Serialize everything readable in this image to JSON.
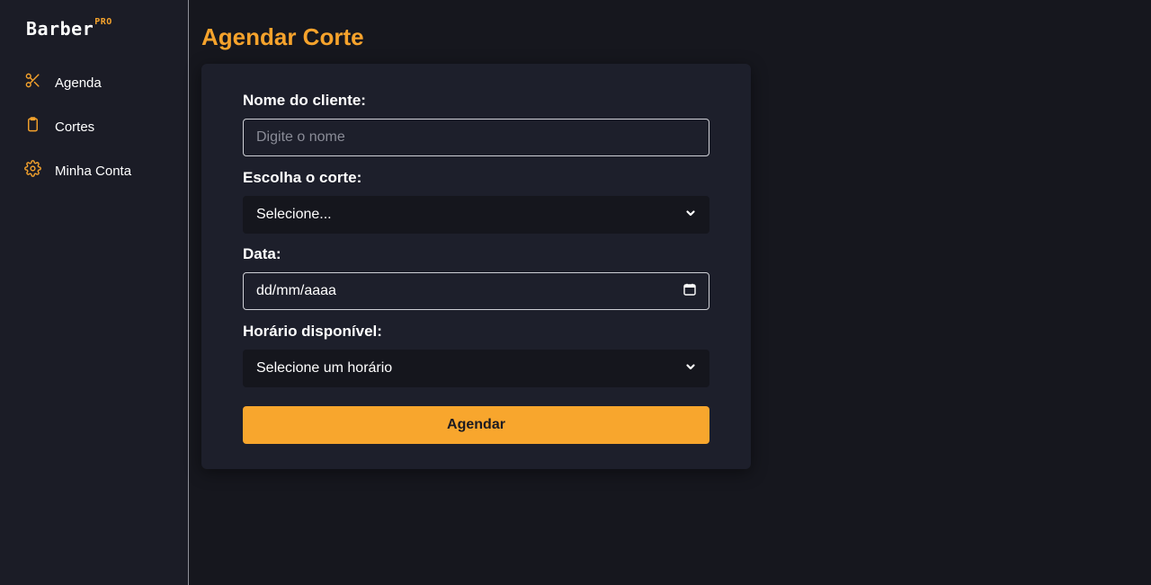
{
  "brand": {
    "name": "Barber",
    "badge": "PRO"
  },
  "sidebar": {
    "items": [
      {
        "label": "Agenda",
        "icon": "scissors-icon"
      },
      {
        "label": "Cortes",
        "icon": "clipboard-icon"
      },
      {
        "label": "Minha Conta",
        "icon": "gear-icon"
      }
    ]
  },
  "page": {
    "title": "Agendar Corte"
  },
  "form": {
    "client_label": "Nome do cliente:",
    "client_placeholder": "Digite o nome",
    "client_value": "",
    "cut_label": "Escolha o corte:",
    "cut_selected": "Selecione...",
    "date_label": "Data:",
    "date_value": "dd/mm/aaaa",
    "time_label": "Horário disponível:",
    "time_selected": "Selecione um horário",
    "submit_label": "Agendar"
  },
  "colors": {
    "accent": "#f6a32c",
    "background": "#16171e",
    "sidebar": "#1b1c26",
    "card": "#1d1f2b",
    "select_bg": "#15161d"
  }
}
